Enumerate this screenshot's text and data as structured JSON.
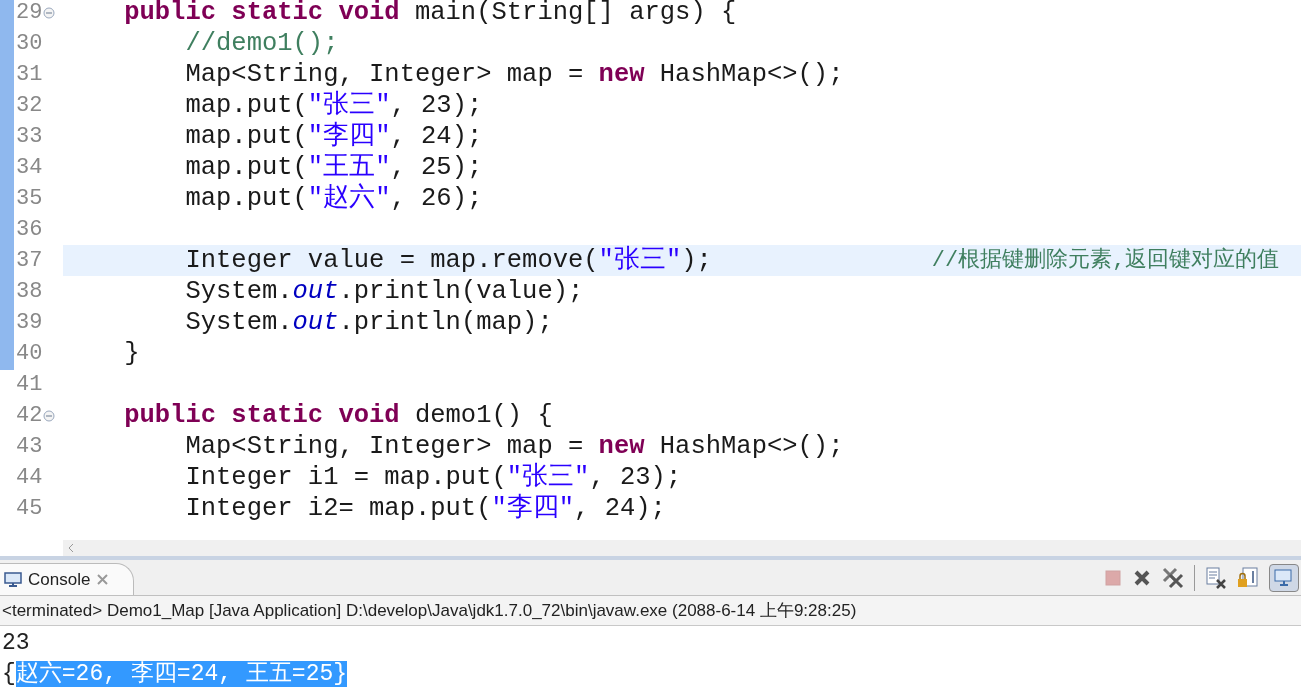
{
  "editor": {
    "lines": [
      {
        "number": "29",
        "fold": true,
        "current": false,
        "tokens": [
          {
            "kind": "keyword",
            "text": "    public static void"
          },
          {
            "kind": "plain",
            "text": " main(String[] args) {"
          }
        ]
      },
      {
        "number": "30",
        "fold": false,
        "current": false,
        "tokens": [
          {
            "kind": "comment",
            "text": "        //demo1();"
          }
        ]
      },
      {
        "number": "31",
        "fold": false,
        "current": false,
        "tokens": [
          {
            "kind": "plain",
            "text": "        Map<String, Integer> map = "
          },
          {
            "kind": "keyword",
            "text": "new"
          },
          {
            "kind": "plain",
            "text": " HashMap<>();"
          }
        ]
      },
      {
        "number": "32",
        "fold": false,
        "current": false,
        "tokens": [
          {
            "kind": "plain",
            "text": "        map.put("
          },
          {
            "kind": "string",
            "text": "\"张三\""
          },
          {
            "kind": "plain",
            "text": ", 23);"
          }
        ]
      },
      {
        "number": "33",
        "fold": false,
        "current": false,
        "tokens": [
          {
            "kind": "plain",
            "text": "        map.put("
          },
          {
            "kind": "string",
            "text": "\"李四\""
          },
          {
            "kind": "plain",
            "text": ", 24);"
          }
        ]
      },
      {
        "number": "34",
        "fold": false,
        "current": false,
        "tokens": [
          {
            "kind": "plain",
            "text": "        map.put("
          },
          {
            "kind": "string",
            "text": "\"王五\""
          },
          {
            "kind": "plain",
            "text": ", 25);"
          }
        ]
      },
      {
        "number": "35",
        "fold": false,
        "current": false,
        "tokens": [
          {
            "kind": "plain",
            "text": "        map.put("
          },
          {
            "kind": "string",
            "text": "\"赵六\""
          },
          {
            "kind": "plain",
            "text": ", 26);"
          }
        ]
      },
      {
        "number": "36",
        "fold": false,
        "current": false
      },
      {
        "number": "37",
        "fold": false,
        "current": true,
        "tokens": [
          {
            "kind": "plain",
            "text": "        Integer value = map.remove("
          },
          {
            "kind": "string",
            "text": "\"张三\""
          },
          {
            "kind": "plain",
            "text": ");"
          }
        ],
        "comment": "//根据键删除元素,返回键对应的值"
      },
      {
        "number": "38",
        "fold": false,
        "current": false,
        "tokens": [
          {
            "kind": "plain",
            "text": "        System."
          },
          {
            "kind": "field",
            "text": "out"
          },
          {
            "kind": "plain",
            "text": ".println(value);"
          }
        ]
      },
      {
        "number": "39",
        "fold": false,
        "current": false,
        "tokens": [
          {
            "kind": "plain",
            "text": "        System."
          },
          {
            "kind": "field",
            "text": "out"
          },
          {
            "kind": "plain",
            "text": ".println(map);"
          }
        ]
      },
      {
        "number": "40",
        "fold": false,
        "current": false,
        "tokens": [
          {
            "kind": "plain",
            "text": "    }"
          }
        ]
      },
      {
        "number": "41",
        "fold": false,
        "current": false
      },
      {
        "number": "42",
        "fold": true,
        "current": false,
        "tokens": [
          {
            "kind": "keyword",
            "text": "    public static void"
          },
          {
            "kind": "plain",
            "text": " demo1() {"
          }
        ]
      },
      {
        "number": "43",
        "fold": false,
        "current": false,
        "tokens": [
          {
            "kind": "plain",
            "text": "        Map<String, Integer> map = "
          },
          {
            "kind": "keyword",
            "text": "new"
          },
          {
            "kind": "plain",
            "text": " HashMap<>();"
          }
        ]
      },
      {
        "number": "44",
        "fold": false,
        "current": false,
        "tokens": [
          {
            "kind": "plain",
            "text": "        Integer i1 = map.put("
          },
          {
            "kind": "string",
            "text": "\"张三\""
          },
          {
            "kind": "plain",
            "text": ", 23);"
          }
        ]
      },
      {
        "number": "45",
        "fold": false,
        "current": false,
        "tokens": [
          {
            "kind": "plain",
            "text": "        Integer i2= map.put("
          },
          {
            "kind": "string",
            "text": "\"李四\""
          },
          {
            "kind": "plain",
            "text": ", 24);"
          }
        ]
      }
    ]
  },
  "console": {
    "tab": {
      "label": "Console",
      "selected": true
    },
    "toolbar": [
      {
        "kind": "stop",
        "disabled": true
      },
      {
        "kind": "remove",
        "disabled": false
      },
      {
        "kind": "remove-all",
        "disabled": false
      },
      {
        "kind": "separator"
      },
      {
        "kind": "clear",
        "disabled": false
      },
      {
        "kind": "scroll-lock",
        "disabled": false
      },
      {
        "kind": "display",
        "disabled": false
      }
    ],
    "status": "<terminated> Demo1_Map [Java Application] D:\\develop\\Java\\jdk1.7.0_72\\bin\\javaw.exe (2088-6-14 上午9:28:25)",
    "output": [
      {
        "text": "23"
      },
      {
        "text": "{",
        "selected_text": "赵六=26, 李四=24, 王五=25}"
      }
    ]
  }
}
